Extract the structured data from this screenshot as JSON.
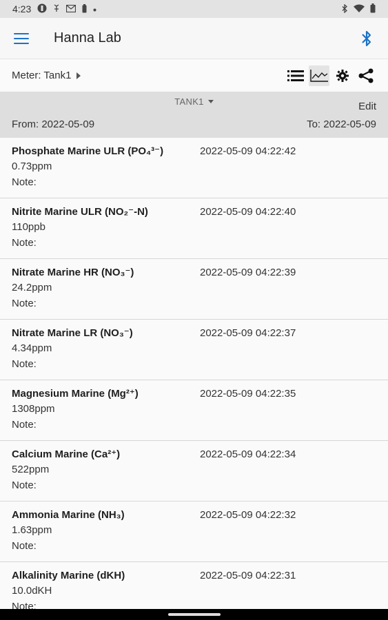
{
  "status": {
    "time": "4:23",
    "left_icons": [
      "notification-icon",
      "android-icon",
      "gmail-icon",
      "battery-saver-icon",
      "dot-icon"
    ],
    "right_icons": [
      "bluetooth-status-icon",
      "wifi-icon",
      "battery-icon"
    ]
  },
  "appbar": {
    "title": "Hanna Lab",
    "accent": "#1a73c9"
  },
  "meter": {
    "label": "Meter: Tank1"
  },
  "toolbar": {
    "icons": [
      "list-icon",
      "chart-icon",
      "gear-icon",
      "share-icon"
    ],
    "active": "chart-icon"
  },
  "range": {
    "tank": "TANK1",
    "edit": "Edit",
    "from": "From: 2022-05-09",
    "to": "To: 2022-05-09"
  },
  "readings": [
    {
      "name": "Phosphate Marine ULR (PO₄³⁻)",
      "value": "0.73ppm",
      "note": "Note:",
      "time": "2022-05-09 04:22:42"
    },
    {
      "name": "Nitrite Marine ULR (NO₂⁻-N)",
      "value": "110ppb",
      "note": "Note:",
      "time": "2022-05-09 04:22:40"
    },
    {
      "name": "Nitrate Marine HR (NO₃⁻)",
      "value": "24.2ppm",
      "note": "Note:",
      "time": "2022-05-09 04:22:39"
    },
    {
      "name": "Nitrate Marine LR (NO₃⁻)",
      "value": "4.34ppm",
      "note": "Note:",
      "time": "2022-05-09 04:22:37"
    },
    {
      "name": "Magnesium Marine (Mg²⁺)",
      "value": "1308ppm",
      "note": "Note:",
      "time": "2022-05-09 04:22:35"
    },
    {
      "name": "Calcium Marine (Ca²⁺)",
      "value": "522ppm",
      "note": "Note:",
      "time": "2022-05-09 04:22:34"
    },
    {
      "name": "Ammonia Marine (NH₃)",
      "value": "1.63ppm",
      "note": "Note:",
      "time": "2022-05-09 04:22:32"
    },
    {
      "name": "Alkalinity Marine (dKH)",
      "value": "10.0dKH",
      "note": "Note:",
      "time": "2022-05-09 04:22:31"
    }
  ]
}
